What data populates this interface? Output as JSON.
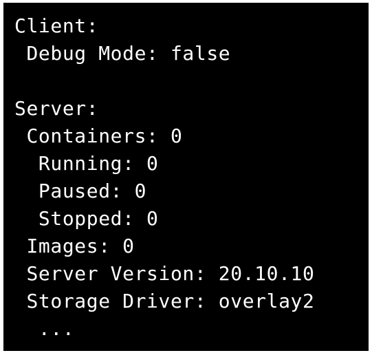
{
  "terminal": {
    "background": "#000000",
    "foreground": "#ffffff",
    "lines": [
      "Client:",
      " Debug Mode: false",
      "",
      "Server:",
      " Containers: 0",
      "  Running: 0",
      "  Paused: 0",
      "  Stopped: 0",
      " Images: 0",
      " Server Version: 20.10.10",
      " Storage Driver: overlay2",
      "  ..."
    ]
  }
}
